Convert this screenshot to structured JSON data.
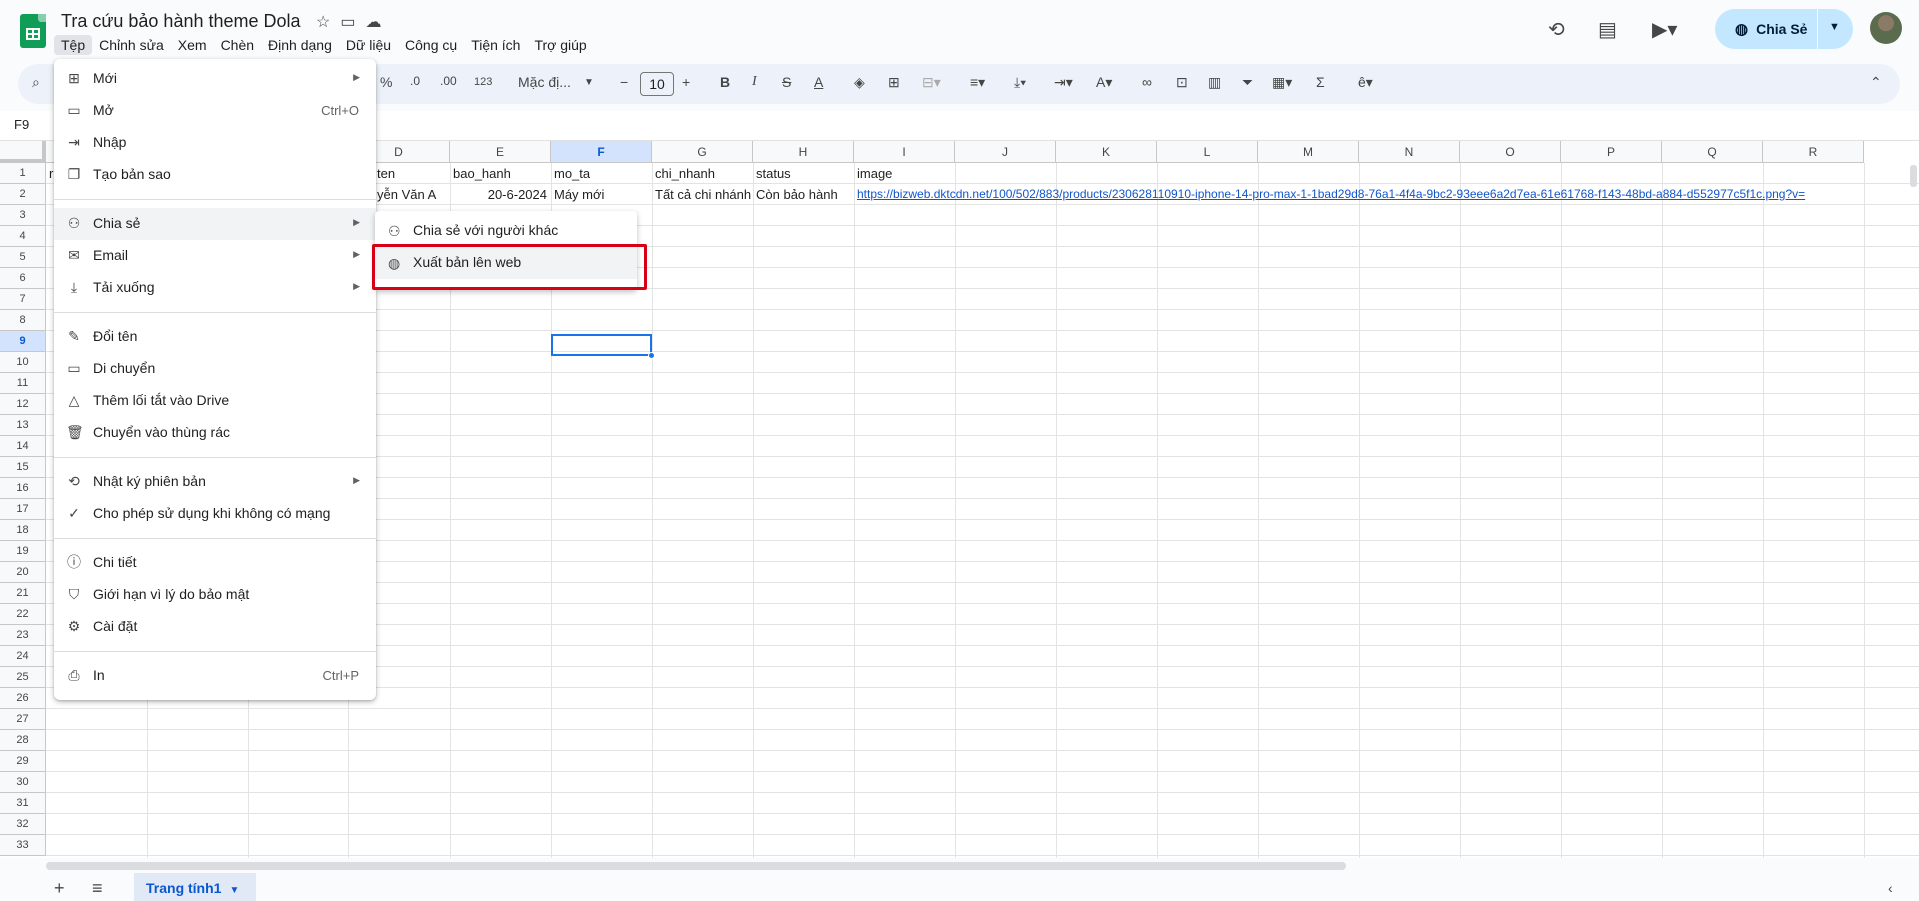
{
  "app": {
    "doc_title": "Tra cứu bảo hành theme Dola",
    "share_label": "Chia Sẻ"
  },
  "menubar": [
    "Tệp",
    "Chỉnh sửa",
    "Xem",
    "Chèn",
    "Định dạng",
    "Dữ liệu",
    "Công cụ",
    "Tiện ích",
    "Trợ giúp"
  ],
  "toolbar": {
    "percent": "%",
    "dec_decrease": ".0",
    "dec_increase": ".00",
    "number_format": "123",
    "font_name": "Mặc đị...",
    "font_size": "10",
    "bold": "B",
    "italic": "I",
    "strike": "S",
    "text_color": "A",
    "sum": "Σ"
  },
  "namebox": "F9",
  "grid": {
    "columns": [
      "D",
      "E",
      "F",
      "G",
      "H",
      "I",
      "J",
      "K",
      "L",
      "M",
      "N",
      "O",
      "P",
      "Q",
      "R"
    ],
    "selected_column": "F",
    "rows": [
      "1",
      "2",
      "3",
      "4",
      "5",
      "6",
      "7",
      "8",
      "9",
      "10",
      "11",
      "12",
      "13",
      "14",
      "15",
      "16",
      "17",
      "18",
      "19",
      "20",
      "21",
      "22",
      "23",
      "24",
      "25",
      "26",
      "27",
      "28",
      "29",
      "30",
      "31",
      "32",
      "33"
    ],
    "selected_row": "9",
    "row1": {
      "a": "r",
      "d": "ten",
      "e": "bao_hanh",
      "f": "mo_ta",
      "g": "chi_nhanh",
      "h": "status",
      "i": "image"
    },
    "row2": {
      "d": "yễn Văn A",
      "e": "20-6-2024",
      "f": "Máy mới",
      "g": "Tất cả chi nhánh",
      "h": "Còn bảo hành",
      "i": "https://bizweb.dktcdn.net/100/502/883/products/230628110910-iphone-14-pro-max-1-1bad29d8-76a1-4f4a-9bc2-93eee6a2d7ea-61e61768-f143-48bd-a884-d552977c5f1c.png?v="
    }
  },
  "sheet_tab": "Trang tính1",
  "file_menu": {
    "items": [
      {
        "label": "Mới",
        "shortcut": "",
        "submenu": true
      },
      {
        "label": "Mở",
        "shortcut": "Ctrl+O",
        "submenu": false
      },
      {
        "label": "Nhập",
        "shortcut": "",
        "submenu": false
      },
      {
        "label": "Tạo bản sao",
        "shortcut": "",
        "submenu": false
      },
      {
        "label": "Chia sẻ",
        "shortcut": "",
        "submenu": true
      },
      {
        "label": "Email",
        "shortcut": "",
        "submenu": true
      },
      {
        "label": "Tải xuống",
        "shortcut": "",
        "submenu": true
      },
      {
        "label": "Đổi tên",
        "shortcut": "",
        "submenu": false
      },
      {
        "label": "Di chuyển",
        "shortcut": "",
        "submenu": false
      },
      {
        "label": "Thêm lối tắt vào Drive",
        "shortcut": "",
        "submenu": false
      },
      {
        "label": "Chuyển vào thùng rác",
        "shortcut": "",
        "submenu": false
      },
      {
        "label": "Nhật ký phiên bản",
        "shortcut": "",
        "submenu": true
      },
      {
        "label": "Cho phép sử dụng khi không có mạng",
        "shortcut": "",
        "submenu": false
      },
      {
        "label": "Chi tiết",
        "shortcut": "",
        "submenu": false
      },
      {
        "label": "Giới hạn vì lý do bảo mật",
        "shortcut": "",
        "submenu": false
      },
      {
        "label": "Cài đặt",
        "shortcut": "",
        "submenu": false
      },
      {
        "label": "In",
        "shortcut": "Ctrl+P",
        "submenu": false
      }
    ]
  },
  "share_submenu": {
    "items": [
      {
        "label": "Chia sẻ với người khác"
      },
      {
        "label": "Xuất bản lên web"
      }
    ]
  },
  "colors": {
    "accent": "#1a73e8",
    "share_button": "#c2e7ff",
    "highlight_box": "#d70015",
    "sheets_green": "#0f9d58"
  }
}
